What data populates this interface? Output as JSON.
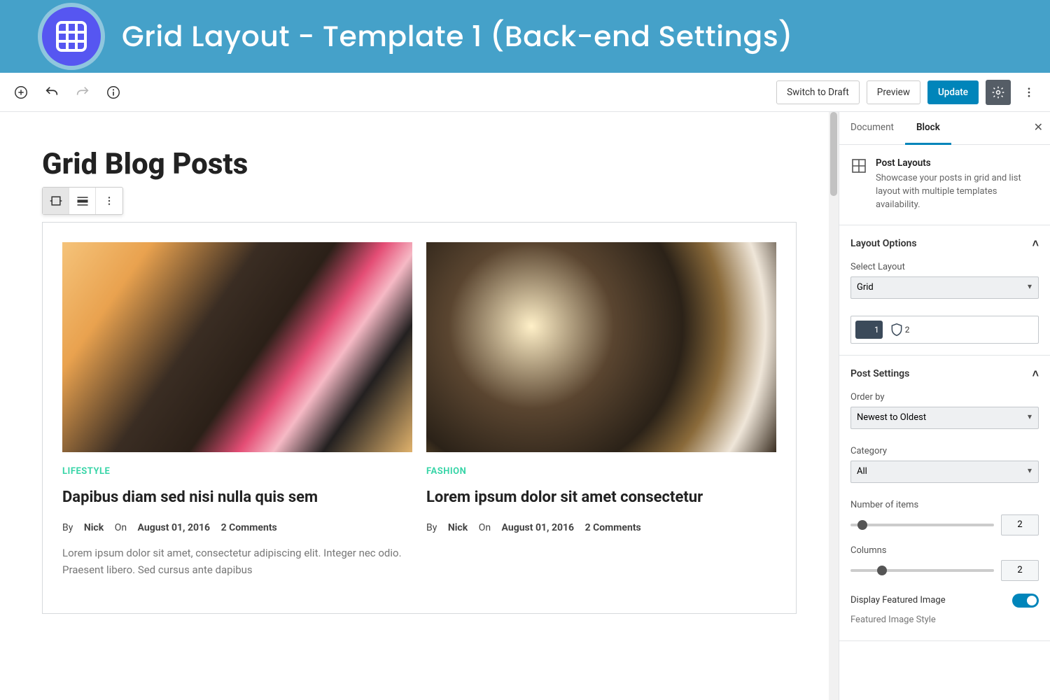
{
  "banner": {
    "title": "Grid Layout - Template 1 (Back-end Settings)"
  },
  "topbar": {
    "switch_draft": "Switch to Draft",
    "preview": "Preview",
    "update": "Update"
  },
  "page": {
    "title": "Grid Blog Posts"
  },
  "posts": [
    {
      "category": "LIFESTYLE",
      "title": "Dapibus diam sed nisi nulla quis sem",
      "author": "Nick",
      "date": "August 01, 2016",
      "comments": "2 Comments",
      "by": "By",
      "on": "On",
      "excerpt": "Lorem ipsum dolor sit amet, consectetur adipiscing elit. Integer nec odio. Praesent libero. Sed cursus ante dapibus"
    },
    {
      "category": "FASHION",
      "title": "Lorem ipsum dolor sit amet consectetur",
      "author": "Nick",
      "date": "August 01, 2016",
      "comments": "2 Comments",
      "by": "By",
      "on": "On",
      "excerpt": ""
    }
  ],
  "sidebar": {
    "tabs": {
      "document": "Document",
      "block": "Block"
    },
    "block_info": {
      "name": "Post Layouts",
      "desc": "Showcase your posts in grid and list layout with multiple templates availability."
    },
    "layout": {
      "header": "Layout Options",
      "select_label": "Select Layout",
      "select_value": "Grid",
      "template1": "1",
      "template2": "2"
    },
    "post_settings": {
      "header": "Post Settings",
      "order_label": "Order by",
      "order_value": "Newest to Oldest",
      "category_label": "Category",
      "category_value": "All",
      "items_label": "Number of items",
      "items_value": "2",
      "columns_label": "Columns",
      "columns_value": "2",
      "display_featured": "Display Featured Image",
      "featured_style": "Featured Image Style"
    }
  }
}
